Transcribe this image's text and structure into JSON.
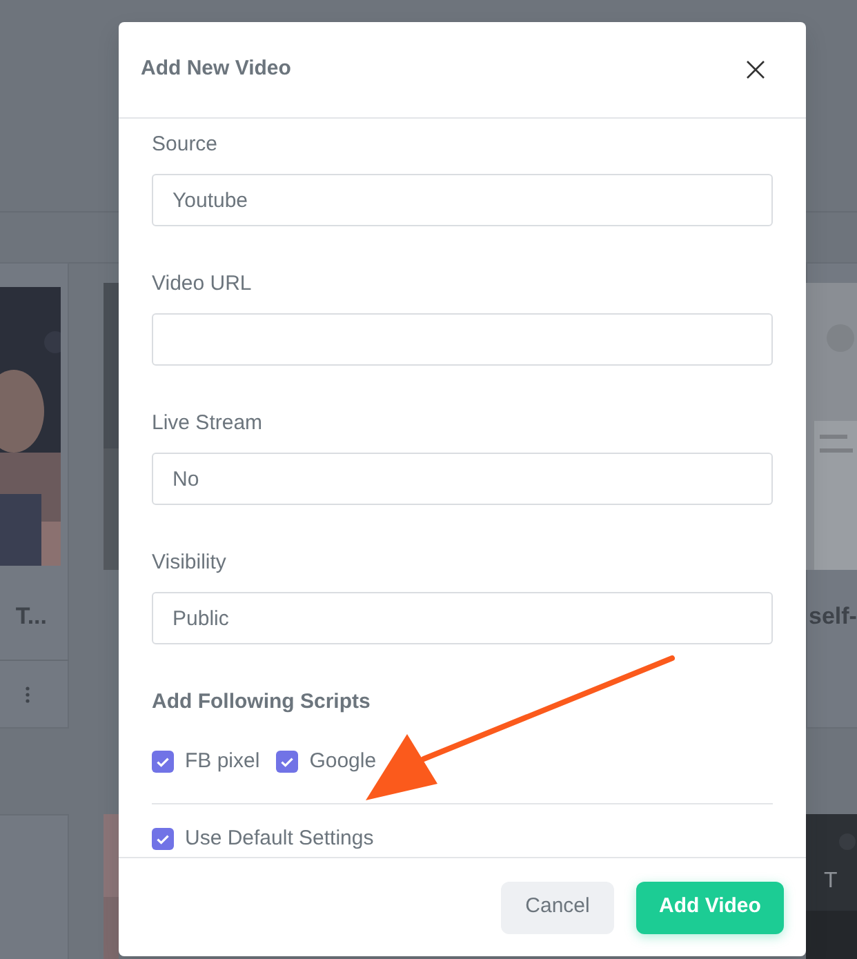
{
  "background": {
    "cards": [
      {
        "title": "T...",
        "kind": "left"
      },
      {
        "title": "self-",
        "kind": "right"
      }
    ],
    "thumbnail_text": "T"
  },
  "modal": {
    "title": "Add New Video",
    "fields": [
      {
        "label": "Source",
        "value": "Youtube"
      },
      {
        "label": "Video URL"
      },
      {
        "label": "Live Stream",
        "value": "No"
      },
      {
        "label": "Visibility",
        "value": "Public"
      }
    ],
    "scripts_heading": "Add Following Scripts",
    "scripts": [
      {
        "label": "FB pixel",
        "checked": true
      },
      {
        "label": "Google",
        "checked": true
      }
    ],
    "default_settings": {
      "label": "Use Default Settings",
      "checked": true
    },
    "buttons": [
      {
        "label": "Cancel",
        "kind": "secondary"
      },
      {
        "label": "Add Video",
        "kind": "primary"
      }
    ]
  }
}
